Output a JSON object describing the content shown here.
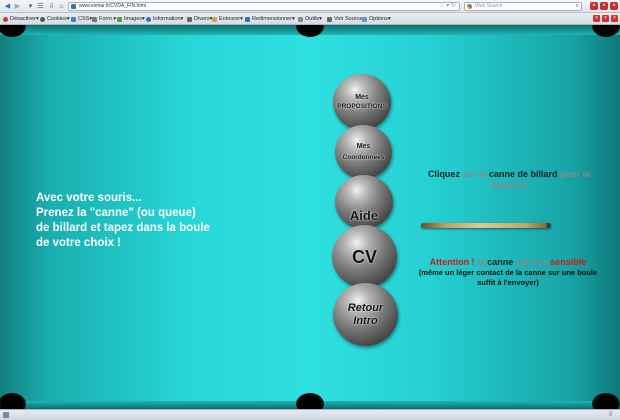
{
  "browser": {
    "url": "www.esmar.fr/CVDA_FIN.html",
    "search_placeholder": "Web Search"
  },
  "toolbar": {
    "items": [
      "Désactiver",
      "Cookies",
      "CSS",
      "Form.",
      "Images",
      "Information",
      "Divers",
      "Entourer",
      "Redimensionner",
      "Outils",
      "Voir Source",
      "Options"
    ]
  },
  "page": {
    "left_text": [
      "Avec votre souris...",
      "Prenez la \"canne\" (ou queue)",
      "de billard et tapez dans la boule",
      "de votre choix !"
    ],
    "balls": [
      {
        "line1": "Mes",
        "line2": "PROPOSITIONS"
      },
      {
        "line1": "Mes",
        "line2": "Coordonnées"
      },
      {
        "line1": "Aide",
        "line2": ""
      },
      {
        "line1": "CV",
        "line2": ""
      },
      {
        "line1": "Retour",
        "line2": "Intro"
      }
    ],
    "instruction": {
      "w1": "Cliquez",
      "w2": "sur la",
      "w3": "canne de billard",
      "w4": "pour la",
      "w5": "déplacer"
    },
    "warning": {
      "a1": "Attention !",
      "a2": "la",
      "a3": "canne",
      "a4": "est très",
      "a5": "sensible",
      "line2": "(même un léger contact de la canne sur une boule",
      "line3": "suffit à l'envoyer)"
    }
  }
}
